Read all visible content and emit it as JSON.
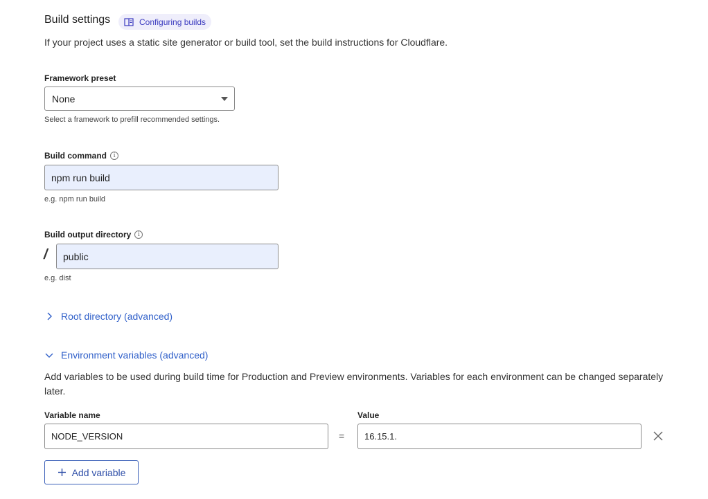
{
  "build_settings": {
    "title": "Build settings",
    "doc_link_label": "Configuring builds",
    "description": "If your project uses a static site generator or build tool, set the build instructions for Cloudflare."
  },
  "framework_preset": {
    "label": "Framework preset",
    "selected": "None",
    "hint": "Select a framework to prefill recommended settings."
  },
  "build_command": {
    "label": "Build command",
    "value": "npm run build",
    "hint": "e.g. npm run build"
  },
  "build_output": {
    "label": "Build output directory",
    "prefix": "/",
    "value": "public",
    "hint": "e.g. dist"
  },
  "root_directory": {
    "label": "Root directory (advanced)"
  },
  "env_vars": {
    "label": "Environment variables (advanced)",
    "description": "Add variables to be used during build time for Production and Preview environments. Variables for each environment can be changed separately later.",
    "name_header": "Variable name",
    "value_header": "Value",
    "rows": [
      {
        "name": "NODE_VERSION",
        "value": "16.15.1."
      }
    ],
    "equals": "=",
    "add_label": "Add variable"
  },
  "colors": {
    "link": "#2f5fc9",
    "filled_input": "#e9effd",
    "pill_bg": "#efeefb"
  }
}
